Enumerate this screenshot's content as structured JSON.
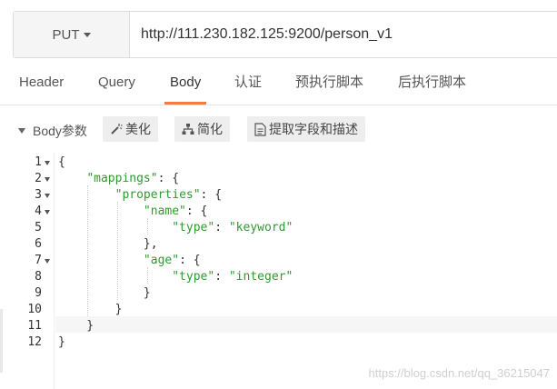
{
  "request": {
    "method": "PUT",
    "url": "http://111.230.182.125:9200/person_v1"
  },
  "tabs": [
    {
      "label": "Header",
      "active": false
    },
    {
      "label": "Query",
      "active": false
    },
    {
      "label": "Body",
      "active": true
    },
    {
      "label": "认证",
      "active": false
    },
    {
      "label": "预执行脚本",
      "active": false
    },
    {
      "label": "后执行脚本",
      "active": false
    }
  ],
  "toolbar": {
    "body_params_label": "Body参数",
    "beautify_label": "美化",
    "simplify_label": "简化",
    "extract_label": "提取字段和描述"
  },
  "editor": {
    "line_numbers": [
      "1",
      "2",
      "3",
      "4",
      "5",
      "6",
      "7",
      "8",
      "9",
      "10",
      "11",
      "12"
    ],
    "lines": [
      "{",
      "    \"mappings\": {",
      "        \"properties\": {",
      "            \"name\": {",
      "                \"type\": \"keyword\"",
      "            },",
      "            \"age\": {",
      "                \"type\": \"integer\"",
      "            }",
      "        }",
      "    }",
      "}"
    ]
  },
  "watermark": "https://blog.csdn.net/qq_36215047",
  "colors": {
    "accent": "#f07c4a",
    "string": "#2f9a2f"
  }
}
